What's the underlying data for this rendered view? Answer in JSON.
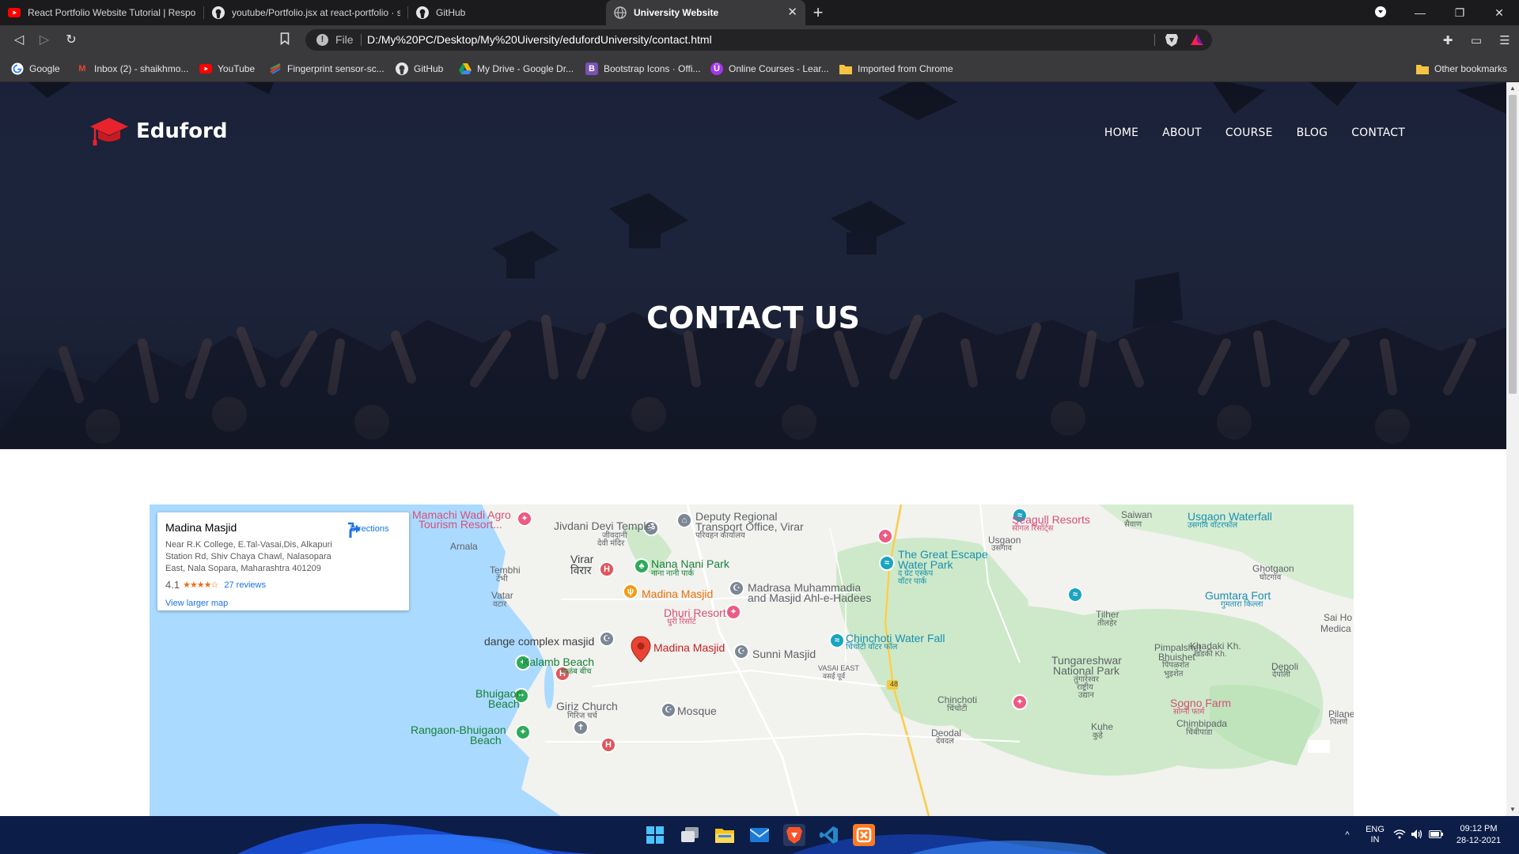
{
  "browser": {
    "tabs": [
      {
        "title": "React Portfolio Website Tutorial | Respons",
        "icon": "youtube-icon"
      },
      {
        "title": "youtube/Portfolio.jsx at react-portfolio · sa",
        "icon": "github-icon"
      },
      {
        "title": "GitHub",
        "icon": "github-icon"
      },
      {
        "title": "University Website",
        "icon": "globe-icon",
        "active": true
      }
    ],
    "address": {
      "scheme": "File",
      "url": "D:/My%20PC/Desktop/My%20Uiversity/edufordUniversity/contact.html"
    },
    "bookmarks": [
      {
        "label": "Google",
        "icon": "google-icon"
      },
      {
        "label": "Inbox (2) - shaikhmo...",
        "icon": "gmail-icon"
      },
      {
        "label": "YouTube",
        "icon": "youtube-icon"
      },
      {
        "label": "Fingerprint sensor-sc...",
        "icon": "fingerprint-icon"
      },
      {
        "label": "GitHub",
        "icon": "github-icon"
      },
      {
        "label": "My Drive - Google Dr...",
        "icon": "drive-icon"
      },
      {
        "label": "Bootstrap Icons · Offi...",
        "icon": "bootstrap-icon"
      },
      {
        "label": "Online Courses - Lear...",
        "icon": "udemy-icon"
      },
      {
        "label": "Imported from Chrome",
        "icon": "folder-icon"
      }
    ],
    "other_bookmarks": "Other bookmarks"
  },
  "site": {
    "brand": "Eduford",
    "nav": [
      "HOME",
      "ABOUT",
      "COURSE",
      "BLOG",
      "CONTACT"
    ],
    "hero_title": "CONTACT US"
  },
  "map": {
    "card": {
      "name": "Madina Masjid",
      "address": "Near R.K College, E.Tal-Vasai,Dis, Alkapuri Station Rd, Shiv Chaya Chawl, Nalasopara East, Nala Sopara, Maharashtra 401209",
      "rating": "4.1",
      "stars": "★★★★☆",
      "reviews": "27 reviews",
      "directions": "Directions",
      "larger_map": "View larger map"
    },
    "labels": {
      "mamachi": "Mamachi Wadi Agro",
      "mamachi2": "Tourism Resort...",
      "jivdani": "Jivdani Devi Temple",
      "jivdani_hi": "जीवदानी",
      "jivdani_hi2": "देवी मंदिर",
      "deputy": "Deputy Regional",
      "deputy2": "Transport Office, Virar",
      "deputy_hi": "परिवहन कार्यालय",
      "seagull": "Seagull Resorts",
      "seagull_hi": "सीगल रिसॉर्ट्स",
      "saiwan": "Saiwan",
      "saiwan_hi": "सैवाण",
      "usgaon": "Usgaon",
      "usgaon_hi": "उसगाव",
      "usgaon_wf": "Usgaon Waterfall",
      "usgaon_wf_hi": "उसगाव वॉटरफॉल",
      "arnala": "Arnala",
      "virar": "Virar",
      "virar_hi": "विरार",
      "nana": "Nana Nani Park",
      "nana_hi": "नाना नानी पार्क",
      "escape": "The Great Escape",
      "escape2": "Water Park",
      "escape_hi": "द ग्रेट एस्केप",
      "escape_hi2": "वॉटर पार्क",
      "ghotgaon": "Ghotgaon",
      "ghotgaon_hi": "घोटगाव",
      "tembhi": "Tembhi",
      "tembhi_hi": "टेंभी",
      "madina_food": "Madina Masjid",
      "madrasa": "Madrasa Muhammadia",
      "madrasa2": "and Masjid Ahl-e-Hadees",
      "gumtara": "Gumtara Fort",
      "gumtara_hi": "गुमतारा किल्ला",
      "vatar": "Vatar",
      "vatar_hi": "वटार",
      "dhuri": "Dhuri Resort",
      "dhuri_hi": "धुरी रिसॉर्ट",
      "tilher": "Tilher",
      "tilher_hi": "तीलहेर",
      "sai": "Sai Ho",
      "medica": "Medica",
      "dange": "dange complex masjid",
      "madina_main": "Madina Masjid",
      "sunni": "Sunni Masjid",
      "chinchoti_wf": "Chinchoti Water Fall",
      "chinchoti_wf_hi": "चिंचोटी वॉटर फॉल",
      "pimpalshet": "Pimpalshet",
      "bhuishet": "Bhuishet",
      "pimpalshet_hi": "पिंपळशेत",
      "bhuishet_hi": "भुइशेत",
      "khadaki": "Khadaki Kh.",
      "khadaki_hi": "खडकी Kh.",
      "kalamb": "Kalamb Beach",
      "kalamb_hi": "कळंब बीच",
      "vasai_east": "VASAI EAST",
      "vasai_east_hi": "वसई पूर्व",
      "tungareshwar": "Tungareshwar",
      "tungareshwar2": "National Park",
      "tungareshwar_hi": "तुंगारेश्वर",
      "tungareshwar_hi2": "राष्ट्रीय",
      "tungareshwar_hi3": "उद्यान",
      "depoli": "Depoli",
      "depoli_hi": "देपोली",
      "bhuigaon": "Bhuigaon",
      "bhuigaon2": "Beach",
      "chinchoti": "Chinchoti",
      "chinchoti_hi": "चिंचोटी",
      "sogno": "Sogno Farm",
      "sogno_hi": "सोग्नो फार्म",
      "giriz": "Giriz Church",
      "giriz_hi": "गिरिज चर्च",
      "mosque": "Mosque",
      "pilane": "Pilane",
      "pilane_hi": "पिलणे",
      "kuhe": "Kuhe",
      "kuhe_hi": "कुहे",
      "chimbipada": "Chimbipada",
      "chimbipada_hi": "चिंबीपाडा",
      "rangaon": "Rangaon-Bhuigaon",
      "rangaon2": "Beach",
      "deodal": "Deodal",
      "deodal_hi": "देवदल",
      "hwy": "48"
    }
  },
  "taskbar": {
    "lang": "ENG",
    "region": "IN",
    "time": "09:12 PM",
    "date": "28-12-2021"
  },
  "colors": {
    "accent_red": "#e8232b",
    "map_water": "#aadaff",
    "map_land": "#f2f2ef",
    "map_park": "#cde9c9"
  }
}
